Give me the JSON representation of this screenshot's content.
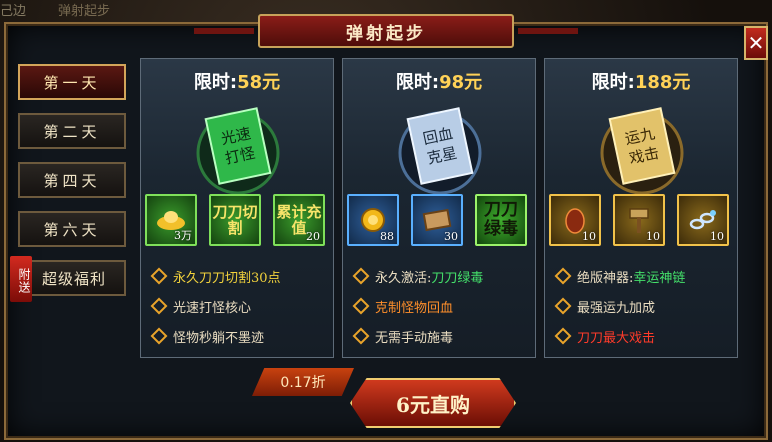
{
  "background": {
    "top_left_text": "己边",
    "top_text": "弹射起步"
  },
  "title": "弹射起步",
  "close_label": "✕",
  "sidebar": {
    "items": [
      {
        "label": "第一天"
      },
      {
        "label": "第二天"
      },
      {
        "label": "第四天"
      },
      {
        "label": "第六天"
      },
      {
        "label": "超级福利",
        "badge": "附送"
      }
    ]
  },
  "cards": [
    {
      "price_label": "限时:",
      "price": "58元",
      "book_text": "光速打怪",
      "book_color": "#2fb84a",
      "items": [
        {
          "icon": "gold-ingot-icon",
          "qty": "3万",
          "text": "",
          "color": "green"
        },
        {
          "icon": "skill-book-icon",
          "qty": "",
          "text": "刀刀切割",
          "color": "green"
        },
        {
          "icon": "skill-book-icon",
          "qty": "20",
          "text": "累计充值",
          "color": "green"
        }
      ],
      "perks": [
        {
          "text": "永久刀刀切割30点",
          "color": "#f2d23c"
        },
        {
          "text": "光速打怪核心",
          "color": "#e9dcc0"
        },
        {
          "text": "怪物秒躺不墨迹",
          "color": "#e9dcc0"
        }
      ]
    },
    {
      "price_label": "限时:",
      "price": "98元",
      "book_text": "回血克星",
      "book_color": "#8fb0d6",
      "items": [
        {
          "icon": "gold-coin-icon",
          "qty": "88",
          "text": "",
          "color": "blue"
        },
        {
          "icon": "scroll-icon",
          "qty": "30",
          "text": "",
          "color": "blue"
        },
        {
          "icon": "text-tile-icon",
          "qty": "",
          "text": "刀刀绿毒",
          "color": "lime"
        }
      ],
      "perks": [
        {
          "text": "永久激活:刀刀绿毒",
          "color": "#e9dcc0",
          "highlight": "刀刀绿毒",
          "highlight_color": "#44e06a"
        },
        {
          "text": "克制怪物回血",
          "color": "#ff8f2a"
        },
        {
          "text": "无需手动施毒",
          "color": "#e9dcc0"
        }
      ]
    },
    {
      "price_label": "限时:",
      "price": "188元",
      "book_text": "运九戏击",
      "book_color": "#d6b45a",
      "items": [
        {
          "icon": "egg-icon",
          "qty": "10",
          "text": "",
          "color": "gold"
        },
        {
          "icon": "hammer-icon",
          "qty": "10",
          "text": "",
          "color": "gold"
        },
        {
          "icon": "chain-icon",
          "qty": "10",
          "text": "",
          "color": "gold"
        }
      ],
      "perks": [
        {
          "text": "绝版神器:幸运神链",
          "color": "#e9dcc0",
          "highlight": "幸运神链",
          "highlight_color": "#44e06a"
        },
        {
          "text": "最强运九加成",
          "color": "#e9dcc0"
        },
        {
          "text": "刀刀最大戏击",
          "color": "#ff3b2a"
        }
      ]
    }
  ],
  "discount": "0.17折",
  "buy_label": "6元直购"
}
